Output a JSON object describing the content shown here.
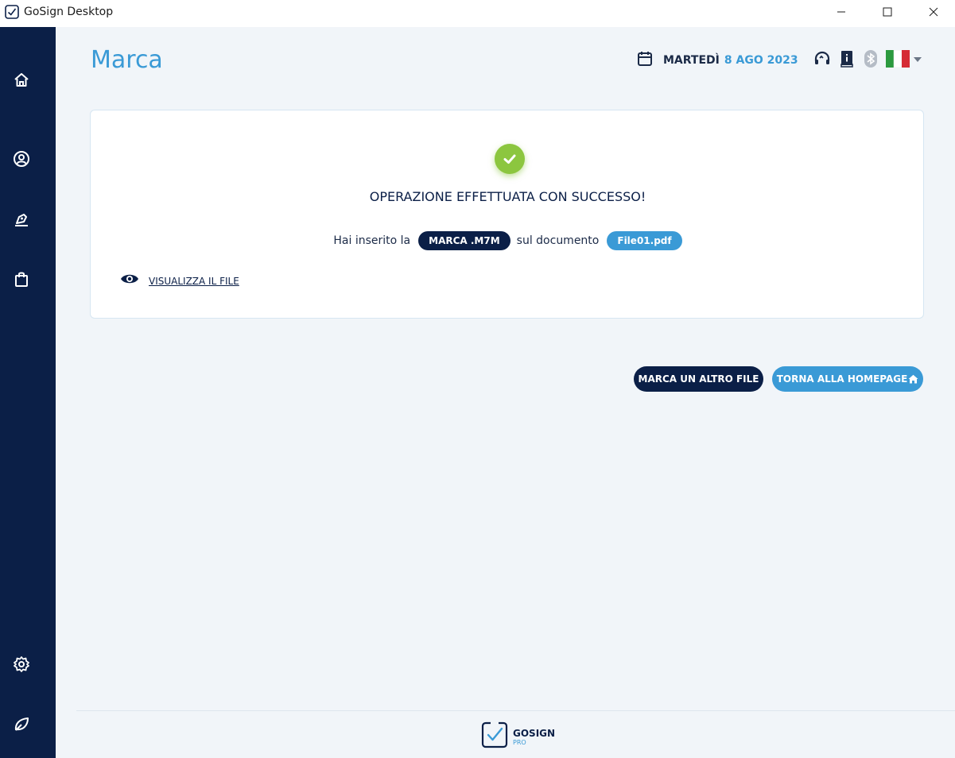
{
  "window": {
    "title": "GoSign Desktop",
    "icons": [
      "gosign-app-icon",
      "minimize-icon",
      "maximize-icon",
      "close-icon"
    ]
  },
  "sidebar": {
    "items": [
      {
        "icon": "home-icon"
      },
      {
        "icon": "user-circle-icon"
      },
      {
        "icon": "pen-sign-icon"
      },
      {
        "icon": "shopping-bag-icon"
      },
      {
        "icon": "gear-icon"
      },
      {
        "icon": "leaf-icon"
      }
    ]
  },
  "header": {
    "page_title": "Marca",
    "date_label": "MARTEDÌ",
    "date_value": "8 AGO 2023",
    "icons": [
      "calendar-icon",
      "headset-icon",
      "info-book-icon",
      "bluetooth-icon",
      "italy-flag-icon",
      "chevron-down-icon"
    ]
  },
  "card": {
    "success_title": "OPERAZIONE EFFETTUATA CON SUCCESSO!",
    "info_prefix": "Hai inserito la",
    "mark_type": "MARCA .M7M",
    "info_middle": "sul documento",
    "file_name": "File01.pdf",
    "view_file_label": "VISUALIZZA IL FILE"
  },
  "actions": {
    "mark_another": "MARCA UN ALTRO FILE",
    "back_home": "TORNA ALLA HOMEPAGE"
  },
  "footer": {
    "logo_main": "GOSIGN",
    "logo_sub": "PRO"
  },
  "colors": {
    "sidebar": "#0b1f47",
    "accent": "#3a9ad6",
    "success": "#8cc63f",
    "background": "#f1f5f9"
  }
}
